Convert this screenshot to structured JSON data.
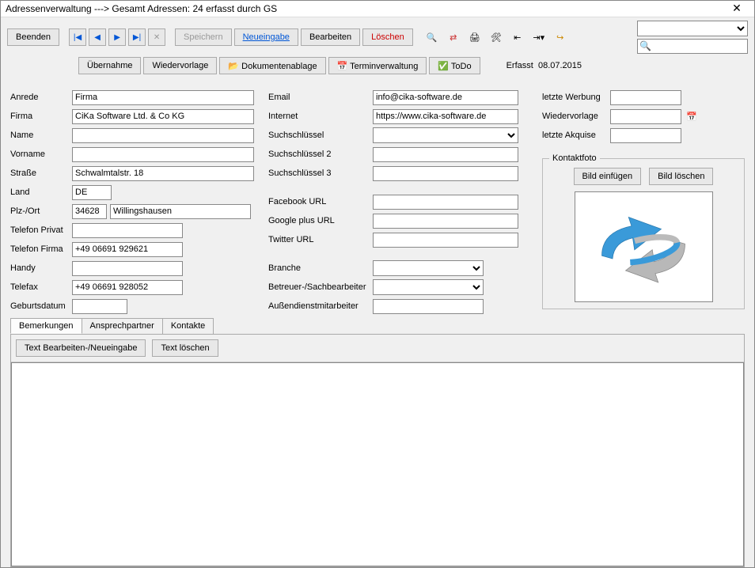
{
  "window": {
    "title": "Adressenverwaltung    --->  Gesamt Adressen: 24  erfasst durch GS"
  },
  "toolbar": {
    "beenden": "Beenden",
    "speichern": "Speichern",
    "neueingabe": "Neueingabe",
    "bearbeiten": "Bearbeiten",
    "loeschen": "Löschen",
    "uebernahme": "Übernahme",
    "wiedervorlage": "Wiedervorlage",
    "dokumentenablage": "Dokumentenablage",
    "terminverwaltung": "Terminverwaltung",
    "todo": "ToDo",
    "erfasst_label": "Erfasst",
    "erfasst_date": "08.07.2015"
  },
  "address": {
    "labels": {
      "anrede": "Anrede",
      "firma": "Firma",
      "name": "Name",
      "vorname": "Vorname",
      "strasse": "Straße",
      "land": "Land",
      "plzort": "Plz-/Ort",
      "tel_privat": "Telefon Privat",
      "tel_firma": "Telefon Firma",
      "handy": "Handy",
      "telefax": "Telefax",
      "geburtsdatum": "Geburtsdatum"
    },
    "anrede": "Firma",
    "firma": "CiKa Software Ltd. & Co KG",
    "name": "",
    "vorname": "",
    "strasse": "Schwalmtalstr. 18",
    "land": "DE",
    "plz": "34628",
    "ort": "Willingshausen",
    "tel_privat": "",
    "tel_firma": "+49 06691 929621",
    "handy": "",
    "telefax": "+49 06691 928052",
    "geburtsdatum": ""
  },
  "contact": {
    "labels": {
      "email": "Email",
      "internet": "Internet",
      "such1": "Suchschlüssel",
      "such2": "Suchschlüssel 2",
      "such3": "Suchschlüssel 3",
      "facebook": "Facebook URL",
      "googleplus": "Google plus URL",
      "twitter": "Twitter URL",
      "branche": "Branche",
      "betreuer": "Betreuer-/Sachbearbeiter",
      "aussendienst": "Außendienstmitarbeiter"
    },
    "email": "info@cika-software.de",
    "internet": "https://www.cika-software.de",
    "such1": "",
    "such2": "",
    "such3": "",
    "facebook": "",
    "googleplus": "",
    "twitter": "",
    "branche": "",
    "betreuer": "",
    "aussendienst": ""
  },
  "right": {
    "labels": {
      "letzte_werbung": "letzte Werbung",
      "wiedervorlage": "Wiedervorlage",
      "letzte_akquise": "letzte Akquise"
    },
    "letzte_werbung": "",
    "wiedervorlage": "",
    "letzte_akquise": "",
    "kontaktfoto_legend": "Kontaktfoto",
    "bild_einfuegen": "Bild einfügen",
    "bild_loeschen": "Bild löschen"
  },
  "tabs": {
    "bemerkungen": "Bemerkungen",
    "ansprechpartner": "Ansprechpartner",
    "kontakte": "Kontakte",
    "text_bearbeiten": "Text Bearbeiten-/Neueingabe",
    "text_loeschen": "Text löschen"
  }
}
